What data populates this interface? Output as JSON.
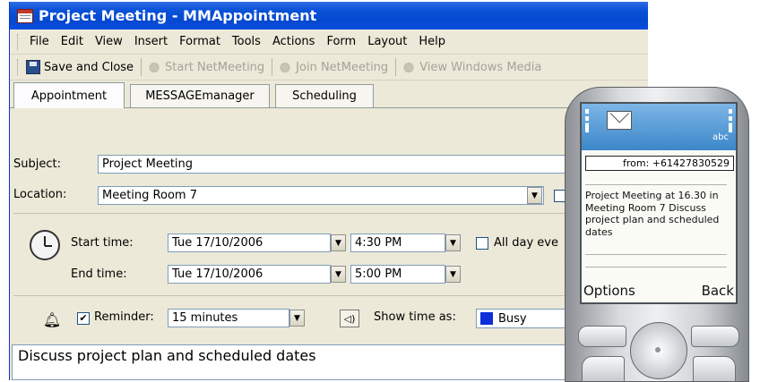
{
  "window": {
    "title": "Project Meeting - MMAppointment"
  },
  "menu": [
    "File",
    "Edit",
    "View",
    "Insert",
    "Format",
    "Tools",
    "Actions",
    "Form",
    "Layout",
    "Help"
  ],
  "toolbar": {
    "save_close": "Save and Close",
    "start_netmeeting": "Start NetMeeting",
    "join_netmeeting": "Join NetMeeting",
    "view_windows_media": "View Windows Media"
  },
  "tabs": [
    "Appointment",
    "MESSAGEmanager",
    "Scheduling"
  ],
  "form": {
    "subject_label": "Subject:",
    "subject_value": "Project Meeting",
    "location_label": "Location:",
    "location_value": "Meeting Room 7",
    "start_label": "Start time:",
    "start_date": "Tue 17/10/2006",
    "start_time": "4:30 PM",
    "allday_label": "All day eve",
    "end_label": "End time:",
    "end_date": "Tue 17/10/2006",
    "end_time": "5:00 PM",
    "reminder_label": "Reminder:",
    "reminder_checked": true,
    "reminder_value": "15 minutes",
    "showtime_label": "Show time as:",
    "showtime_value": "Busy",
    "busy_color": "#0b2fd8",
    "notes": "Discuss project plan and scheduled dates"
  },
  "phone": {
    "from": "from: +61427830529",
    "message_lines": [
      "Project Meeting at 16.30 in",
      "Meeting Room 7 Discuss",
      "project plan and scheduled",
      "dates"
    ],
    "abc": "abc",
    "left_softkey": "Options",
    "right_softkey": "Back"
  }
}
